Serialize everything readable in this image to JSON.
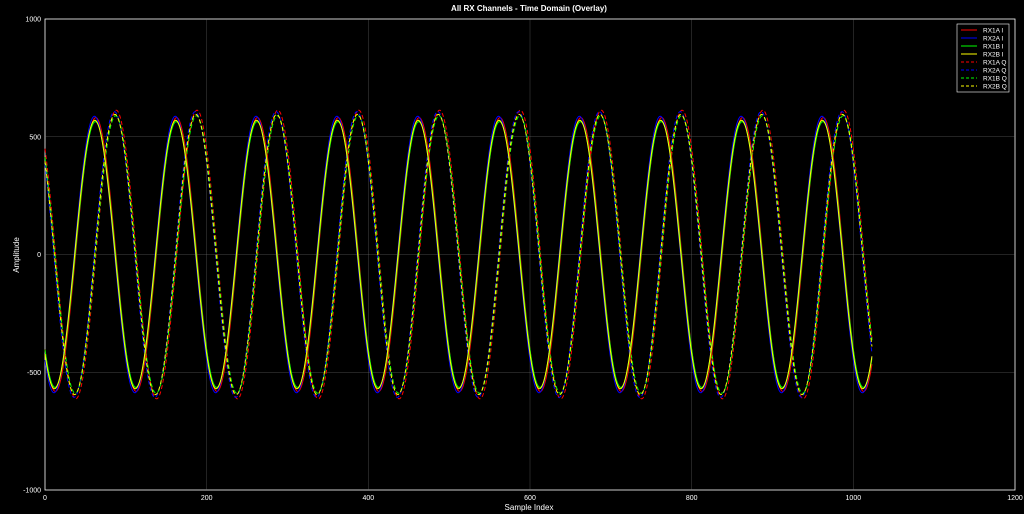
{
  "chart_data": {
    "type": "line",
    "title": "All RX Channels - Time Domain (Overlay)",
    "xlabel": "Sample Index",
    "ylabel": "Amplitude",
    "xlim": [
      0,
      1200
    ],
    "ylim": [
      -1000,
      1000
    ],
    "xticks": [
      0,
      200,
      400,
      600,
      800,
      1000,
      1200
    ],
    "yticks": [
      -1000,
      -500,
      0,
      500,
      1000
    ],
    "grid": true,
    "legend_position": "top-right",
    "background": "#000000",
    "grid_color": "#808080",
    "signal": {
      "samples": 1024,
      "period_samples": 100,
      "i_amplitude": 570,
      "q_amplitude": 595,
      "i_peak_first_sample": 62,
      "q_peak_first_sample": 87
    },
    "series": [
      {
        "name": "RX1A I",
        "color": "#ff0000",
        "style": "solid"
      },
      {
        "name": "RX2A I",
        "color": "#0000ff",
        "style": "solid"
      },
      {
        "name": "RX1B I",
        "color": "#00ff00",
        "style": "solid"
      },
      {
        "name": "RX2B I",
        "color": "#ffff00",
        "style": "solid"
      },
      {
        "name": "RX1A Q",
        "color": "#ff0000",
        "style": "dashed"
      },
      {
        "name": "RX2A Q",
        "color": "#0000ff",
        "style": "dashed"
      },
      {
        "name": "RX1B Q",
        "color": "#00ff00",
        "style": "dashed"
      },
      {
        "name": "RX2B Q",
        "color": "#ffff00",
        "style": "dashed"
      }
    ]
  }
}
